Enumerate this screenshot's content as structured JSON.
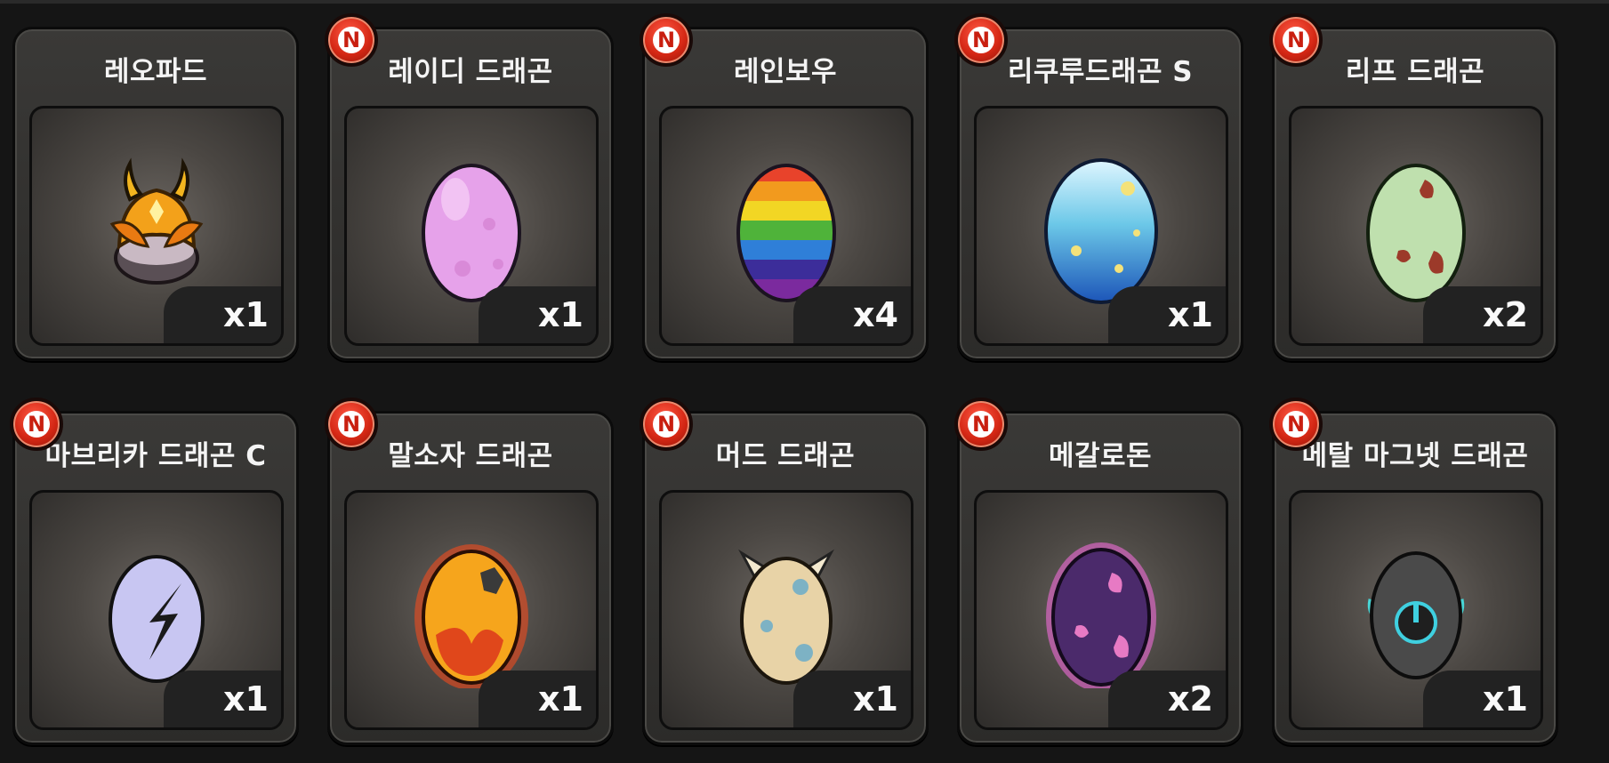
{
  "items": [
    {
      "name": "레오파드",
      "count": "x1",
      "is_new": false,
      "icon": "leopard-egg-icon",
      "row": 0,
      "col": 0
    },
    {
      "name": "레이디 드래곤",
      "count": "x1",
      "is_new": true,
      "icon": "lady-dragon-egg-icon",
      "row": 0,
      "col": 1
    },
    {
      "name": "레인보우",
      "count": "x4",
      "is_new": true,
      "icon": "rainbow-egg-icon",
      "row": 0,
      "col": 2
    },
    {
      "name": "리쿠루드래곤 S",
      "count": "x1",
      "is_new": true,
      "icon": "rikuru-dragon-egg-icon",
      "row": 0,
      "col": 3
    },
    {
      "name": "리프 드래곤",
      "count": "x2",
      "is_new": true,
      "icon": "leaf-dragon-egg-icon",
      "row": 0,
      "col": 4
    },
    {
      "name": "마브리카 드래곤 C",
      "count": "x1",
      "is_new": true,
      "icon": "mabrika-dragon-egg-icon",
      "row": 1,
      "col": 0
    },
    {
      "name": "말소자 드래곤",
      "count": "x1",
      "is_new": true,
      "icon": "malsoja-dragon-egg-icon",
      "row": 1,
      "col": 1
    },
    {
      "name": "머드 드래곤",
      "count": "x1",
      "is_new": true,
      "icon": "mud-dragon-egg-icon",
      "row": 1,
      "col": 2
    },
    {
      "name": "메갈로돈",
      "count": "x2",
      "is_new": true,
      "icon": "megalodon-egg-icon",
      "row": 1,
      "col": 3
    },
    {
      "name": "메탈 마그넷 드래곤",
      "count": "x1",
      "is_new": true,
      "icon": "metal-magnet-dragon-egg-icon",
      "row": 1,
      "col": 4
    }
  ],
  "new_badge_label": "N",
  "colors": {
    "card": "#333230",
    "badge_red": "#d42714",
    "count_bg": "#222222",
    "text": "#f4f4f4"
  }
}
